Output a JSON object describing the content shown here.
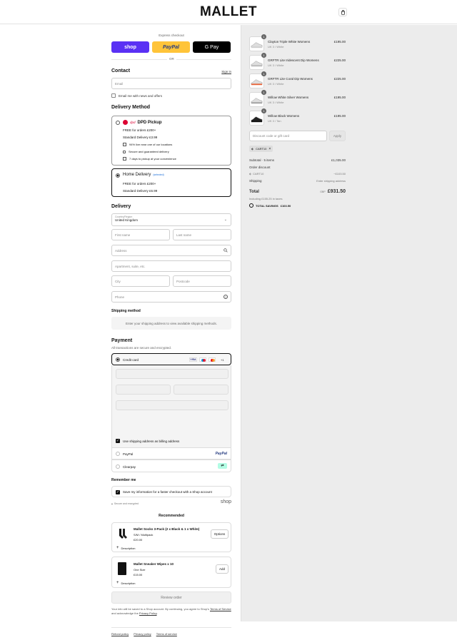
{
  "header": {
    "logo": "MALLET",
    "cart_icon": "shopping-bag-icon"
  },
  "express": {
    "title": "Express checkout",
    "shop_label": "shop",
    "paypal_label": "PayPal",
    "gpay_label": "G Pay",
    "or": "OR",
    "colors": {
      "shop": "#5a31f4",
      "paypal": "#ffc439",
      "gpay": "#000000"
    }
  },
  "contact": {
    "title": "Contact",
    "sign_in": "Sign in",
    "email_placeholder": "Email",
    "news_label": "Email me with news and offers"
  },
  "delivery_method": {
    "title": "Delivery Method",
    "pickup": {
      "brand": "dpd",
      "title": "DPD Pickup",
      "free": "FREE for orders £200+",
      "standard": "Standard Delivery £3.99",
      "features": [
        {
          "icon": "building-icon",
          "text": "94% live near one of our locations"
        },
        {
          "icon": "lock-icon",
          "text": "Secure and guaranteed delivery"
        },
        {
          "icon": "calendar-icon",
          "text": "7 days to pickup at your convenience"
        }
      ]
    },
    "home": {
      "title": "Home Delivery",
      "tag": "(selected)",
      "free": "FREE for orders £200+",
      "standard": "Standard Delivery £6.99"
    }
  },
  "delivery": {
    "title": "Delivery",
    "country_label": "Country/Region",
    "country_value": "United Kingdom",
    "first_name": "First name",
    "last_name": "Last name",
    "address": "Address",
    "apartment": "Apartment, suite, etc.",
    "city": "City",
    "postcode": "Postcode",
    "phone": "Phone",
    "shipping_method_title": "Shipping method",
    "shipping_method_msg": "Enter your shipping address to view available shipping methods."
  },
  "payment": {
    "title": "Payment",
    "subtitle": "All transactions are secure and encrypted.",
    "credit_card": "Credit card",
    "more_cards": "+1",
    "billing_label": "Use shipping address as billing address",
    "paypal": "PayPal",
    "clearpay": "Clearpay"
  },
  "remember": {
    "title": "Remember me",
    "save_label": "Save my information for a faster checkout with a Shop account",
    "secure": "Secure and encrypted",
    "shop": "shop"
  },
  "recommended": {
    "title": "Recommended",
    "items": [
      {
        "name": "Mallet Socks 3-Pack (2 x Black & 1 x White)",
        "variant": "S/M / Multipack",
        "price": "£20.00",
        "button": "Options",
        "desc": "Description"
      },
      {
        "name": "Mallet Sneaker Wipes x 10",
        "variant": "One Size",
        "price": "£15.00",
        "button": "Add",
        "desc": "Description"
      }
    ]
  },
  "review_button": "Review order",
  "legal": {
    "prefix": "Your info will be saved to a Shop account. By continuing, you agree to Shop's ",
    "terms": "Terms of Service",
    "middle": " and acknowledge the ",
    "privacy": "Privacy Policy",
    "suffix": "."
  },
  "footer_links": [
    "Refund policy",
    "Privacy policy",
    "Terms of service"
  ],
  "cart": {
    "items": [
      {
        "qty": "1",
        "name": "Clayton Triple White Womens",
        "variant": "UK 3 / White",
        "price": "£195.00",
        "accent": "#cfcfcf"
      },
      {
        "qty": "1",
        "name": "GRFTR Lite Iridescent Dip Womens",
        "variant": "UK 3 / White",
        "price": "£225.00",
        "accent": "#b9b9b9"
      },
      {
        "qty": "1",
        "name": "GRFTR Lite Coral Dip Womens",
        "variant": "UK 3 / White",
        "price": "£225.00",
        "accent": "#e8663c"
      },
      {
        "qty": "1",
        "name": "Willow White Silver Womens",
        "variant": "UK 3 / White",
        "price": "£195.00",
        "accent": "#a0a0a0"
      },
      {
        "qty": "1",
        "name": "Willow Black Womens",
        "variant": "UK 3 / Tan",
        "price": "£195.00",
        "accent": "#111111"
      }
    ],
    "discount_placeholder": "Discount code or gift card",
    "apply": "Apply",
    "code_chip": "CART10",
    "subtotal_label": "Subtotal · 5 items",
    "subtotal_value": "£1,035.00",
    "order_discount": "Order discount",
    "discount_code": "CART10",
    "discount_value": "−£103.50",
    "shipping_label": "Shipping",
    "shipping_value": "Enter shipping address",
    "total_label": "Total",
    "currency": "GBP",
    "total_value": "£931.50",
    "taxes": "Including £155.25 in taxes",
    "savings_label": "TOTAL SAVINGS",
    "savings_value": "£103.50"
  }
}
